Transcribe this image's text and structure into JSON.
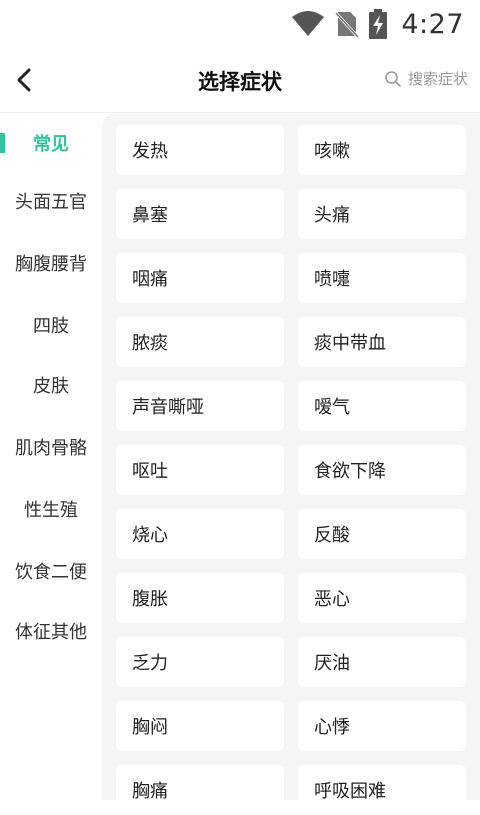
{
  "status": {
    "time": "4:27",
    "icons": [
      "wifi-icon",
      "no-sim-icon",
      "battery-charging-icon"
    ]
  },
  "header": {
    "title": "选择症状",
    "search_label": "搜索症状",
    "icons": [
      "back-arrow-icon",
      "search-icon"
    ]
  },
  "colors": {
    "accent": "#2fc3a0",
    "content_bg": "#f5f5f5"
  },
  "sidebar": {
    "items": [
      {
        "label": "常见",
        "active": true
      },
      {
        "label": "头面五官"
      },
      {
        "label": "胸腹腰背"
      },
      {
        "label": "四肢"
      },
      {
        "label": "皮肤"
      },
      {
        "label": "肌肉骨骼"
      },
      {
        "label": "性生殖"
      },
      {
        "label": "饮食二便"
      },
      {
        "label": "体征其他"
      }
    ]
  },
  "symptoms": [
    "发热",
    "咳嗽",
    "鼻塞",
    "头痛",
    "咽痛",
    "喷嚏",
    "脓痰",
    "痰中带血",
    "声音嘶哑",
    "嗳气",
    "呕吐",
    "食欲下降",
    "烧心",
    "反酸",
    "腹胀",
    "恶心",
    "乏力",
    "厌油",
    "胸闷",
    "心悸",
    "胸痛",
    "呼吸困难"
  ]
}
